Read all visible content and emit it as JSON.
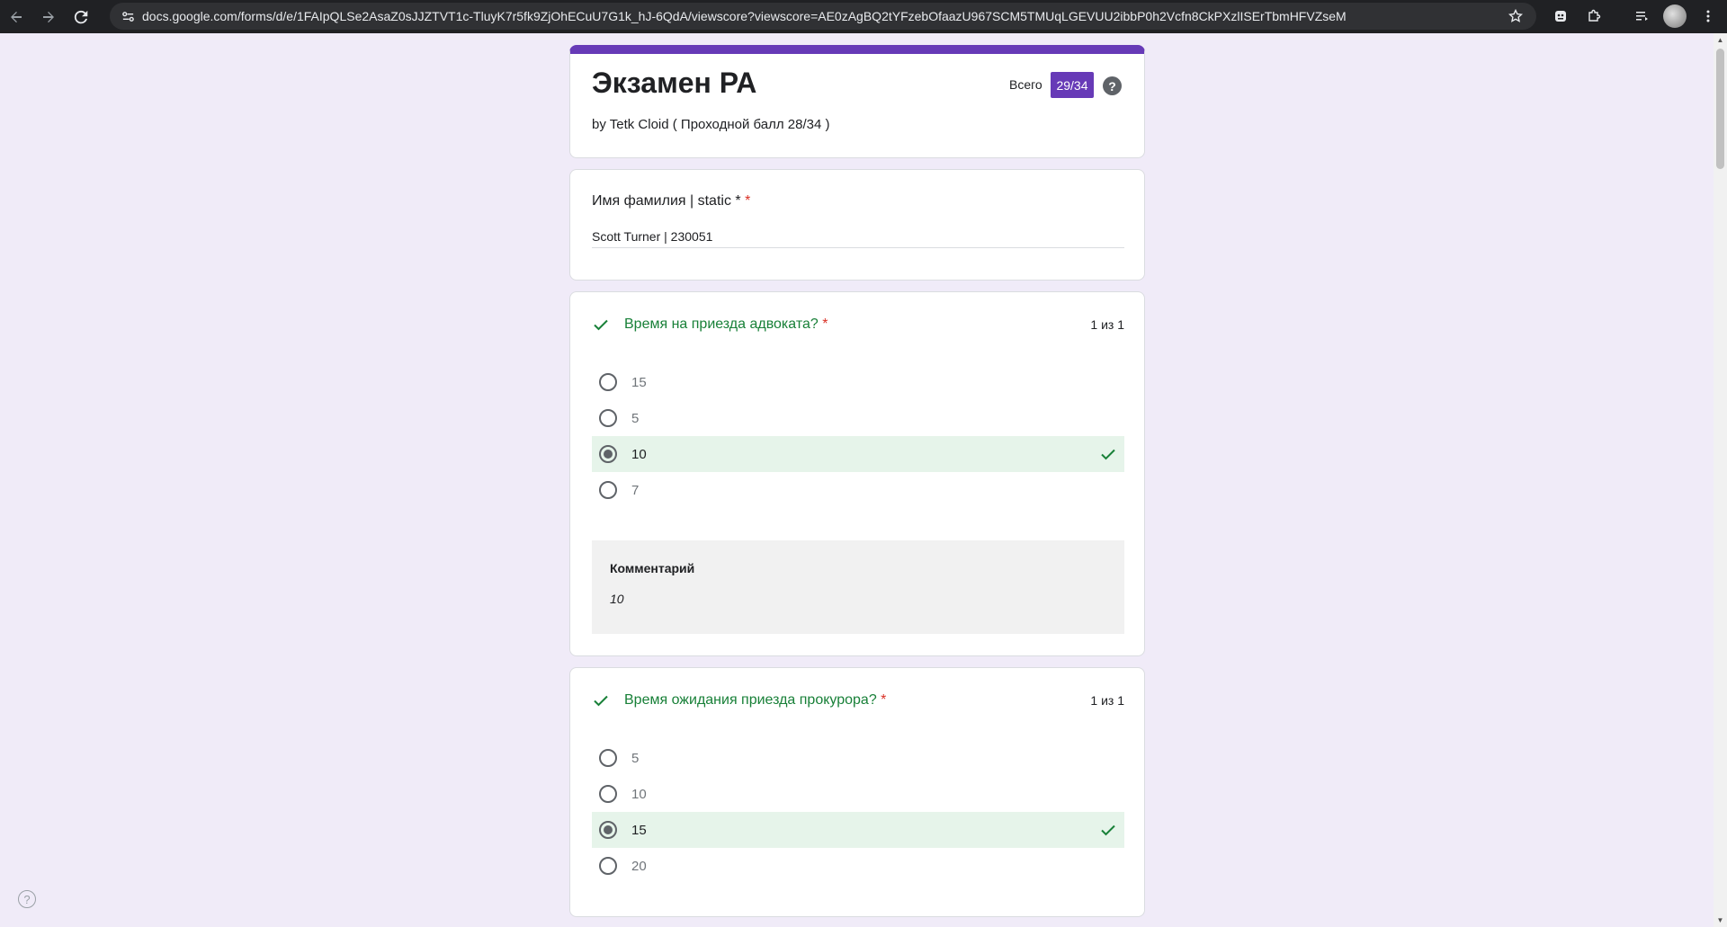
{
  "browser": {
    "url": "docs.google.com/forms/d/e/1FAIpQLSe2AsaZ0sJJZTVT1c-TluyK7r5fk9ZjOhECuU7G1k_hJ-6QdA/viewscore?viewscore=AE0zAgBQ2tYFzebOfaazU967SCM5TMUqLGEVUU2ibbP0h2Vcfn8CkPXzlISErTbmHFVZseM"
  },
  "header": {
    "title": "Экзамен РА",
    "description": "by Tetk Cloid ( Проходной балл 28/34 )",
    "score_label": "Всего",
    "score": "29/34",
    "help": "?"
  },
  "name_question": {
    "title": "Имя фамилия | static *",
    "required": "*",
    "answer": "Scott Turner | 230051"
  },
  "questions": [
    {
      "title": "Время на приезда адвоката?",
      "required": "*",
      "points": "1 из 1",
      "options": [
        "15",
        "5",
        "10",
        "7"
      ],
      "selected_index": 2,
      "comment_label": "Комментарий",
      "comment": "10"
    },
    {
      "title": "Время ожидания приезда прокурора?",
      "required": "*",
      "points": "1 из 1",
      "options": [
        "5",
        "10",
        "15",
        "20"
      ],
      "selected_index": 2
    }
  ],
  "footer": {
    "help": "?"
  },
  "colors": {
    "accent": "#673ab7",
    "correct": "#188038",
    "correct_bg": "#e6f4ea",
    "page_bg": "#f0ebf8"
  }
}
